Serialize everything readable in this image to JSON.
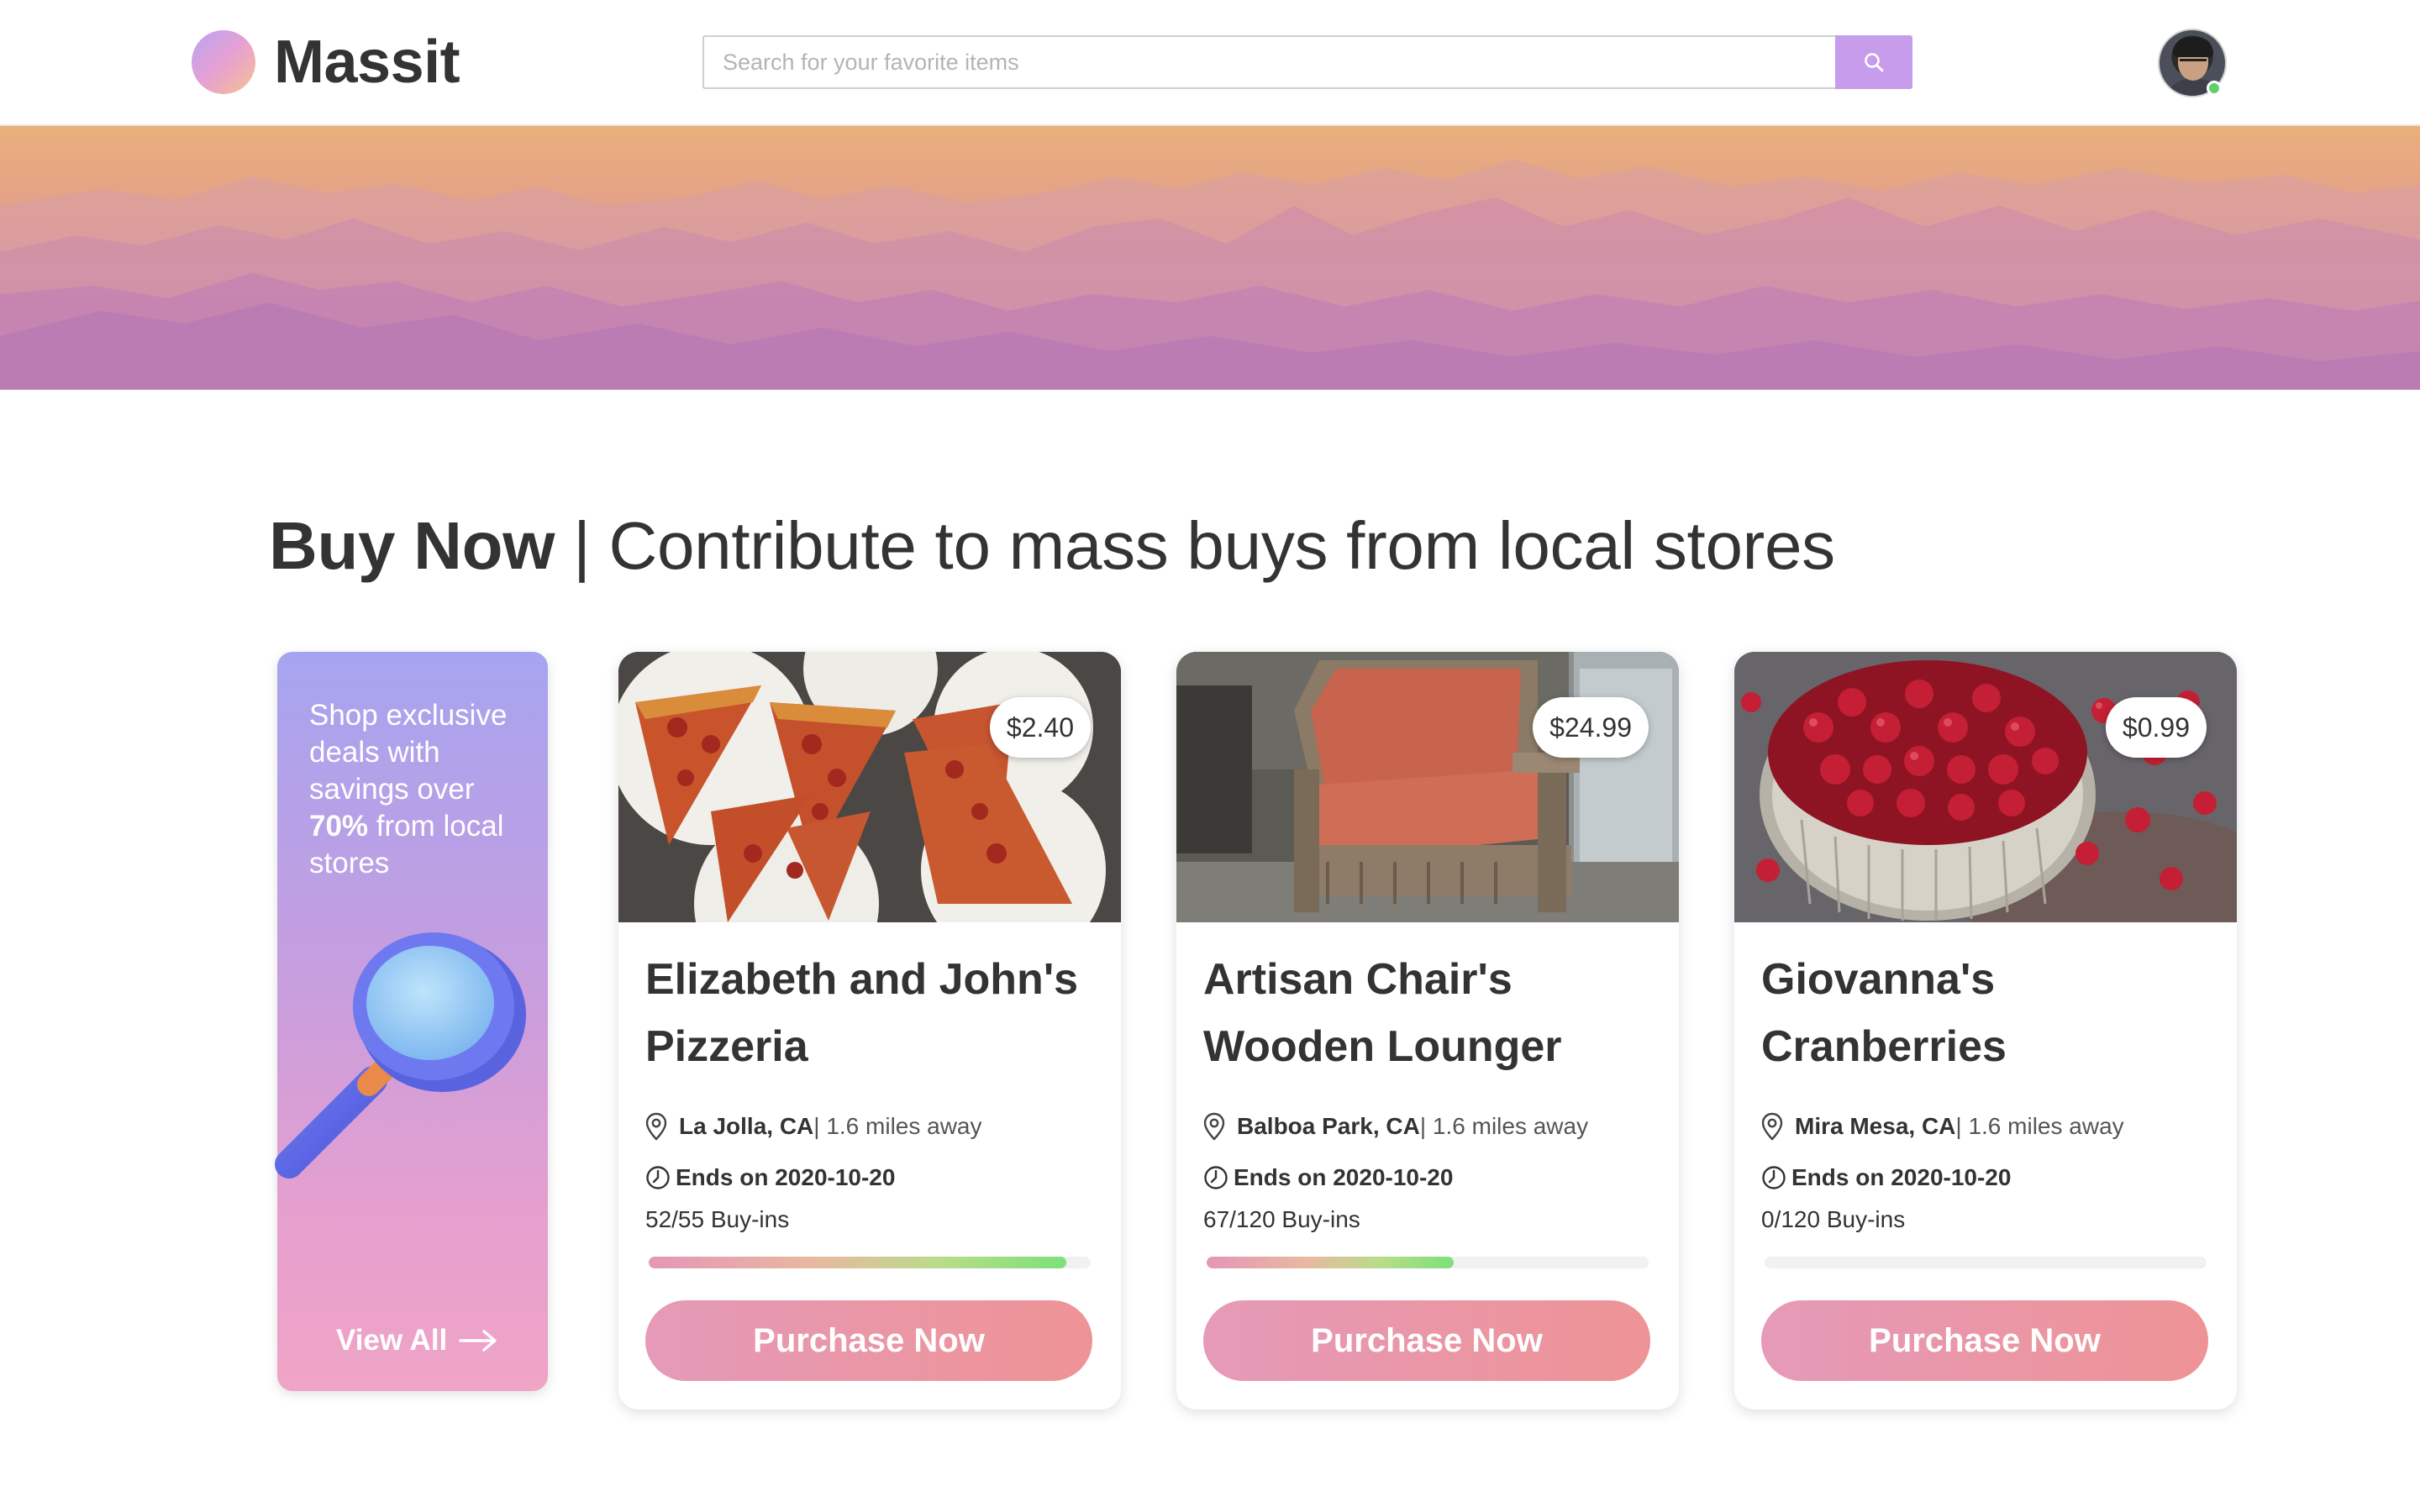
{
  "header": {
    "brand": "Massit",
    "search_placeholder": "Search for your favorite items",
    "search_icon": "search-icon",
    "avatar_status": "online"
  },
  "section": {
    "title_strong": "Buy Now",
    "separator": "|",
    "title_sub": "Contribute to mass buys from local stores"
  },
  "promo": {
    "text_1": "Shop exclusive deals with savings over ",
    "highlight": "70%",
    "text_2": " from local stores",
    "link_label": "View All"
  },
  "products": [
    {
      "price": "$2.40",
      "title": "Elizabeth and John's Pizzeria",
      "location": "La Jolla, CA",
      "distance": " | 1.6 miles away",
      "ends": "Ends on 2020-10-20",
      "buyins": "52/55 Buy-ins",
      "progress": 0.945,
      "button": "Purchase Now",
      "image": "pizza-image"
    },
    {
      "price": "$24.99",
      "title": "Artisan Chair's Wooden Lounger",
      "location": "Balboa Park, CA",
      "distance": " | 1.6 miles away",
      "ends": "Ends on 2020-10-20",
      "buyins": "67/120 Buy-ins",
      "progress": 0.558,
      "button": "Purchase Now",
      "image": "chair-image"
    },
    {
      "price": "$0.99",
      "title": "Giovanna's Cranberries",
      "location": "Mira Mesa, CA",
      "distance": " | 1.6 miles away",
      "ends": "Ends on 2020-10-20",
      "buyins": "0/120 Buy-ins",
      "progress": 0,
      "button": "Purchase Now",
      "image": "cranberries-image"
    }
  ],
  "colors": {
    "accent": "#c79cec",
    "button_start": "#e59ab8",
    "button_end": "#ee9395",
    "progress_end": "#7de07a"
  }
}
